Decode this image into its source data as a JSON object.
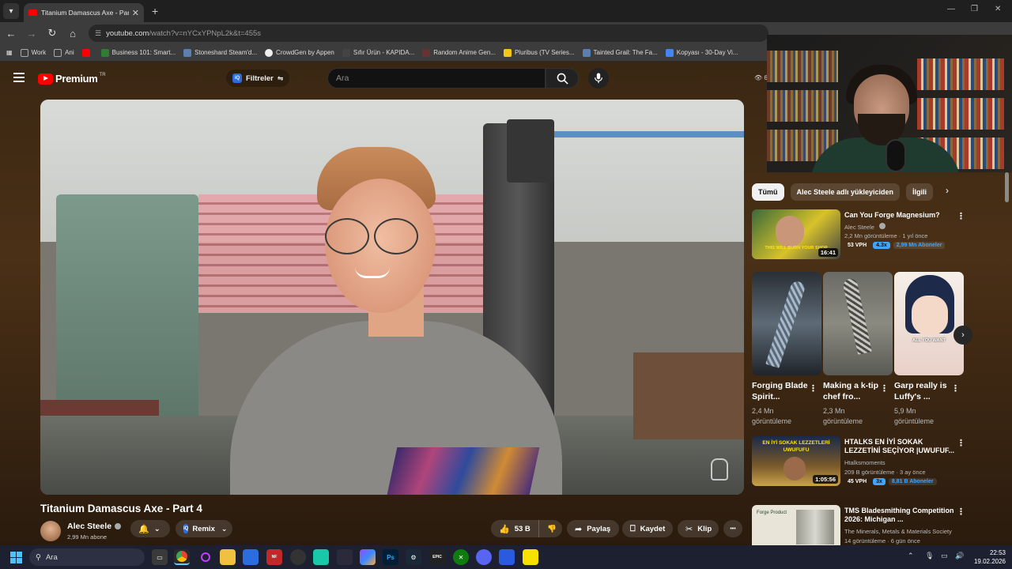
{
  "browser": {
    "tab_title": "Titanium Damascus Axe - Part 4",
    "new_tab_label": "+",
    "url_host": "youtube.com",
    "url_path": "/watch?v=nYCxYPNpL2k&t=455s",
    "bookmarks": [
      {
        "label": "Work",
        "color": "#555555"
      },
      {
        "label": "Ani",
        "color": "#555555"
      },
      {
        "label": "",
        "color": "#ff0000"
      },
      {
        "label": "Business 101: Smart...",
        "color": "#2e7d32"
      },
      {
        "label": "Stoneshard Steam'd...",
        "color": "#1b2838"
      },
      {
        "label": "CrowdGen by Appen",
        "color": "#eeeeee"
      },
      {
        "label": "Sıfır Ürün - KAPIDA...",
        "color": "#444444"
      },
      {
        "label": "Random Anime Gen...",
        "color": "#663333"
      },
      {
        "label": "Pluribus (TV Series...",
        "color": "#f5c518"
      },
      {
        "label": "Tainted Grail: The Fa...",
        "color": "#1b2838"
      },
      {
        "label": "Kopyası - 30-Day Vi...",
        "color": "#4285f4"
      }
    ]
  },
  "youtube": {
    "logo_text": "Premium",
    "logo_region": "TR",
    "filters_label": "Filtreler",
    "search_placeholder": "Ara",
    "views_prefix": "6"
  },
  "video": {
    "title": "Titanium Damascus Axe - Part 4",
    "channel_name": "Alec Steele",
    "channel_subs": "2,99 Mn abone",
    "remix_label": "Remix",
    "likes": "53 B",
    "share_label": "Paylaş",
    "save_label": "Kaydet",
    "clip_label": "Klip",
    "more_label": "•••"
  },
  "sidebar": {
    "chips": [
      "Tümü",
      "Alec Steele adlı yükleyiciden",
      "İlgili"
    ],
    "recommendations": [
      {
        "title": "Can You Forge Magnesium?",
        "channel": "Alec Steele",
        "meta": "2,2 Mn görüntüleme · 1 yıl önce",
        "duration": "16:41",
        "thumb_caption": "THIS WILL BURN YOUR SHOP",
        "vph": "53 VPH",
        "multiplier": "4.3x",
        "subs": "2,99 Mn Aboneler"
      },
      {
        "title": "HTALKS EN İYİ SOKAK LEZZETİNİ SEÇİYOR |UWUFUF...",
        "channel": "Htalksmoments",
        "meta": "209 B görüntüleme · 3 ay önce",
        "duration": "1:05:56",
        "thumb_caption": "EN İYİ SOKAK LEZZETLERİ UWUFUFU",
        "vph": "45 VPH",
        "multiplier": "3x",
        "subs": "8,81 B Aboneler"
      },
      {
        "title": "TMS Bladesmithing Competition 2026: Michigan ...",
        "channel": "The Minerals, Metals & Materials Society",
        "meta": "14 görüntüleme · 6 gün önce",
        "duration": "",
        "thumb_caption": "Forge Product",
        "vph": "",
        "multiplier": "",
        "subs": ""
      }
    ],
    "shorts": [
      {
        "title": "Forging Blade Spirit...",
        "views": "2,4 Mn görüntüleme"
      },
      {
        "title": "Making a k-tip chef fro...",
        "views": "2,3 Mn görüntüleme"
      },
      {
        "title": "Garp really is Luffy's ...",
        "views": "5,9 Mn görüntüleme"
      }
    ],
    "short3_caption": "ALL YOU WANT"
  },
  "taskbar": {
    "search_placeholder": "Ara",
    "time": "22:53",
    "date": "19.02.2026"
  },
  "colors": {
    "accent_red": "#ff0000",
    "badge_blue": "#3ea6ff"
  }
}
